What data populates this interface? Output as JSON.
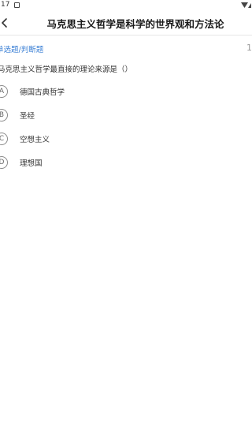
{
  "status": {
    "time": ":17"
  },
  "header": {
    "title": "马克思主义哲学是科学的世界观和方法论"
  },
  "question": {
    "type": "单选题/判断题",
    "index": "1",
    "text": "马克思主义哲学最直接的理论来源是（）",
    "options": [
      {
        "letter": "A",
        "text": "德国古典哲学"
      },
      {
        "letter": "B",
        "text": "圣经"
      },
      {
        "letter": "C",
        "text": "空想主义"
      },
      {
        "letter": "D",
        "text": "理想国"
      }
    ]
  },
  "colors": {
    "accent": "#3a7fd5",
    "divider": "#e6e6e6"
  },
  "icons": {
    "back": "chevron-left-icon",
    "signal": "signal-icon",
    "notification": "notification-icon"
  }
}
